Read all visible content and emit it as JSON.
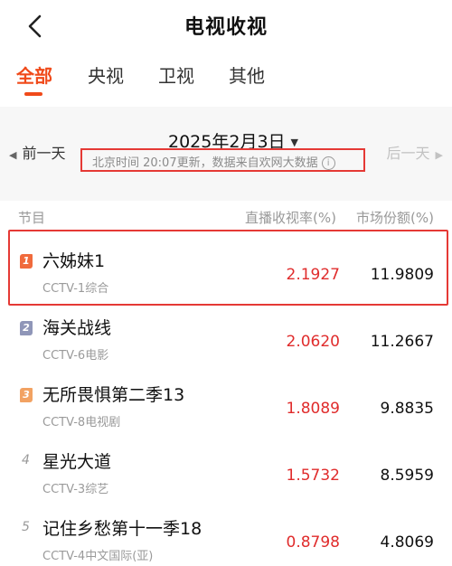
{
  "header": {
    "title": "电视收视",
    "back_icon": "chevron-left-icon"
  },
  "tabs": [
    {
      "label": "全部",
      "active": true
    },
    {
      "label": "央视",
      "active": false
    },
    {
      "label": "卫视",
      "active": false
    },
    {
      "label": "其他",
      "active": false
    }
  ],
  "date_nav": {
    "prev_label": "前一天",
    "next_label": "后一天",
    "current_date": "2025年2月3日",
    "update_note": "北京时间 20:07更新，数据来自欢网大数据",
    "info_icon": "i"
  },
  "columns": {
    "program": "节目",
    "rating": "直播收视率(%)",
    "share": "市场份额(%)"
  },
  "colors": {
    "accent": "#f04a1a",
    "rating_red": "#e02c2c",
    "rank1": "#f06a3c",
    "rank2": "#8f96b8",
    "rank3": "#f2a262",
    "highlight_border": "#e53935"
  },
  "programs": [
    {
      "rank": "1",
      "name": "六姊妹1",
      "channel": "CCTV-1综合",
      "rating": "2.1927",
      "share": "11.9809"
    },
    {
      "rank": "2",
      "name": "海关战线",
      "channel": "CCTV-6电影",
      "rating": "2.0620",
      "share": "11.2667"
    },
    {
      "rank": "3",
      "name": "无所畏惧第二季13",
      "channel": "CCTV-8电视剧",
      "rating": "1.8089",
      "share": "9.8835"
    },
    {
      "rank": "4",
      "name": "星光大道",
      "channel": "CCTV-3综艺",
      "rating": "1.5732",
      "share": "8.5959"
    },
    {
      "rank": "5",
      "name": "记住乡愁第十一季18",
      "channel": "CCTV-4中文国际(亚)",
      "rating": "0.8798",
      "share": "4.8069"
    }
  ]
}
